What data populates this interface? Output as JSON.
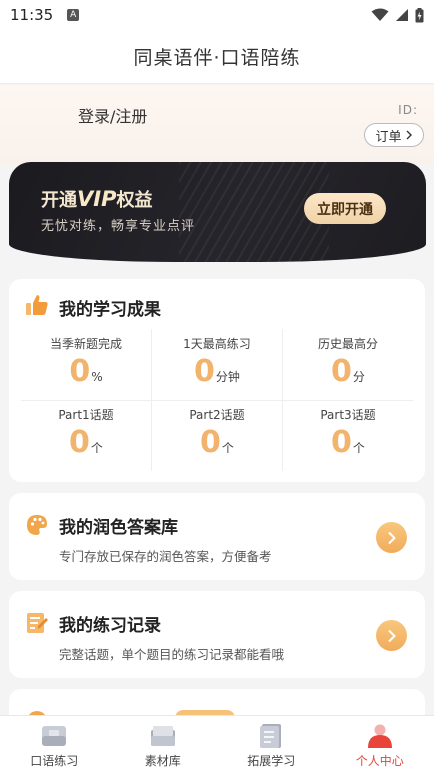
{
  "status_bar": {
    "time": "11:35",
    "notification_icon": "a-notification-icon",
    "icons": [
      "wifi-icon",
      "signal-icon",
      "battery-icon"
    ]
  },
  "header": {
    "title": "同桌语伴·口语陪练"
  },
  "profile": {
    "login_label": "登录/注册",
    "id_label": "ID:",
    "order_label": "订单"
  },
  "vip": {
    "title_prefix": "开通",
    "title_mark": "VIP",
    "title_suffix": "权益",
    "subtitle": "无忧对练，畅享专业点评",
    "button_label": "立即开通",
    "colors": {
      "button": "#f0d2a6",
      "banner": "#1b1a1f"
    }
  },
  "achievements": {
    "title": "我的学习成果",
    "icon": "thumbs-up-icon",
    "stats": [
      {
        "label": "当季新题完成",
        "value": "0",
        "unit": "%"
      },
      {
        "label": "1天最高练习",
        "value": "0",
        "unit": "分钟"
      },
      {
        "label": "历史最高分",
        "value": "0",
        "unit": "分"
      },
      {
        "label": "Part1话题",
        "value": "0",
        "unit": "个"
      },
      {
        "label": "Part2话题",
        "value": "0",
        "unit": "个"
      },
      {
        "label": "Part3话题",
        "value": "0",
        "unit": "个"
      }
    ],
    "accent_color": "#f2b36d"
  },
  "polish": {
    "title": "我的润色答案库",
    "desc": "专门存放已保存的润色答案，方便备考",
    "icon": "palette-icon"
  },
  "record": {
    "title": "我的练习记录",
    "desc": "完整话题，单个题目的练习记录都能看哦",
    "icon": "edit-note-icon"
  },
  "tabs": [
    {
      "label": "口语练习",
      "icon": "speech-practice-icon",
      "active": false
    },
    {
      "label": "素材库",
      "icon": "material-library-icon",
      "active": false
    },
    {
      "label": "拓展学习",
      "icon": "book-icon",
      "active": false
    },
    {
      "label": "个人中心",
      "icon": "profile-icon",
      "active": true
    }
  ],
  "active_tab_color": "#e8443a"
}
